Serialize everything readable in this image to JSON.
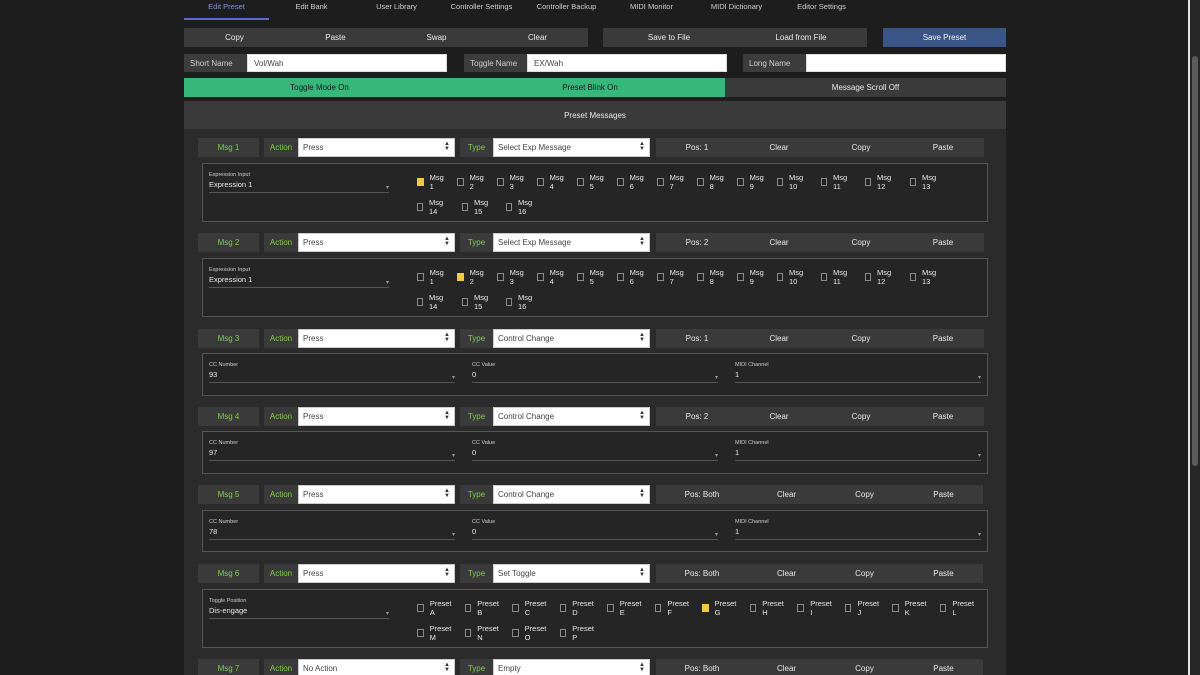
{
  "nav": [
    "Edit Preset",
    "Edit Bank",
    "User Library",
    "Controller Settings",
    "Controller Backup",
    "MIDI Monitor",
    "MIDI Dictionary",
    "Editor Settings"
  ],
  "toolbar": {
    "copy": "Copy",
    "paste": "Paste",
    "swap": "Swap",
    "clear": "Clear",
    "save_file": "Save to File",
    "load_file": "Load from File",
    "save_preset": "Save Preset"
  },
  "names": {
    "short_label": "Short Name",
    "short_value": "Vol/Wah",
    "toggle_label": "Toggle Name",
    "toggle_value": "EX/Wah",
    "long_label": "Long Name",
    "long_value": ""
  },
  "toggles": {
    "mode": "Toggle Mode On",
    "blink": "Preset Blink On",
    "scroll": "Message Scroll Off"
  },
  "panel_title": "Preset Messages",
  "labels": {
    "action": "Action",
    "type": "Type",
    "clear": "Clear",
    "copy": "Copy",
    "paste": "Paste"
  },
  "messages": [
    {
      "name": "Msg 1",
      "action": "Press",
      "type": "Select Exp Message",
      "pos": "Pos: 1"
    },
    {
      "name": "Msg 2",
      "action": "Press",
      "type": "Select Exp Message",
      "pos": "Pos: 2"
    },
    {
      "name": "Msg 3",
      "action": "Press",
      "type": "Control Change",
      "pos": "Pos: 1"
    },
    {
      "name": "Msg 4",
      "action": "Press",
      "type": "Control Change",
      "pos": "Pos: 2"
    },
    {
      "name": "Msg 5",
      "action": "Press",
      "type": "Control Change",
      "pos": "Pos: Both"
    },
    {
      "name": "Msg 6",
      "action": "Press",
      "type": "Set Toggle",
      "pos": "Pos: Both"
    },
    {
      "name": "Msg 7",
      "action": "No Action",
      "type": "Empty",
      "pos": "Pos: Both"
    }
  ],
  "expr": {
    "label": "Expression Input",
    "value1": "Expression 1",
    "value2": "Expression 1"
  },
  "cc": {
    "number_label": "CC Number",
    "value_label": "CC Value",
    "channel_label": "MIDI Channel",
    "m3": {
      "number": "93",
      "value": "0",
      "channel": "1"
    },
    "m4": {
      "number": "97",
      "value": "0",
      "channel": "1"
    },
    "m5": {
      "number": "78",
      "value": "0",
      "channel": "1"
    }
  },
  "toggle_pos": {
    "label": "Toggle Position",
    "value": "Dis-engage"
  },
  "msg_checks": [
    "Msg 1",
    "Msg 2",
    "Msg 3",
    "Msg 4",
    "Msg 5",
    "Msg 6",
    "Msg 7",
    "Msg 8",
    "Msg 9",
    "Msg 10",
    "Msg 11",
    "Msg 12",
    "Msg 13",
    "Msg 14",
    "Msg 15",
    "Msg 16"
  ],
  "preset_checks": [
    "Preset A",
    "Preset B",
    "Preset C",
    "Preset D",
    "Preset E",
    "Preset F",
    "Preset G",
    "Preset H",
    "Preset I",
    "Preset J",
    "Preset K",
    "Preset L",
    "Preset M",
    "Preset N",
    "Preset O",
    "Preset P"
  ],
  "colors": {
    "green": "#35b87a",
    "accent_text": "#7fd04a",
    "blue": "#3a5585",
    "checked": "#f0c84a"
  }
}
